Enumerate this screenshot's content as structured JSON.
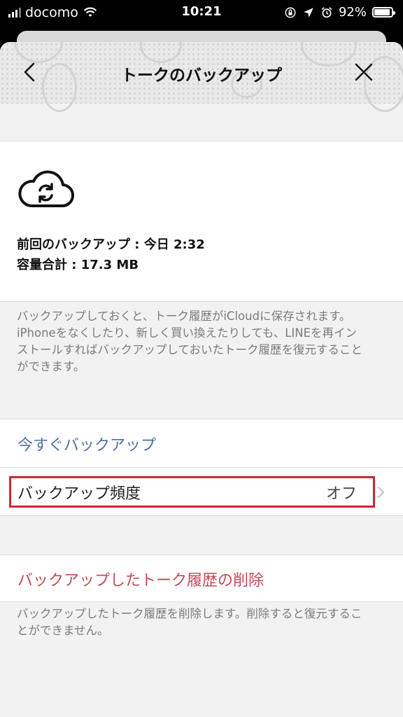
{
  "status_bar": {
    "carrier": "docomo",
    "time": "10:21",
    "battery": "92%",
    "battery_level": 0.92,
    "icons": [
      "signal-icon",
      "wifi-icon",
      "orientation-lock-icon",
      "location-icon",
      "alarm-icon",
      "battery-icon"
    ]
  },
  "header": {
    "title": "トークのバックアップ",
    "back_icon": "chevron-left-icon",
    "close_icon": "close-icon"
  },
  "backup_info": {
    "icon": "cloud-sync-icon",
    "last_backup": "前回のバックアップ : 今日 2:32",
    "total_size": "容量合計 : 17.3 MB"
  },
  "description": "バックアップしておくと、トーク履歴がiCloudに保存されます。\niPhoneをなくしたり、新しく買い換えたりしても、LINEを再インストールすればバックアップしておいたトーク履歴を復元することができます。",
  "actions": {
    "backup_now": "今すぐバックアップ",
    "frequency_label": "バックアップ頻度",
    "frequency_value": "オフ"
  },
  "delete": {
    "label": "バックアップしたトーク履歴の削除",
    "note": "バックアップしたトーク履歴を削除します。削除すると復元することができません。"
  },
  "colors": {
    "link_blue": "#4e6fa5",
    "danger_red": "#c44a58",
    "highlight_red": "#d02535",
    "background": "#f2f2f2"
  }
}
